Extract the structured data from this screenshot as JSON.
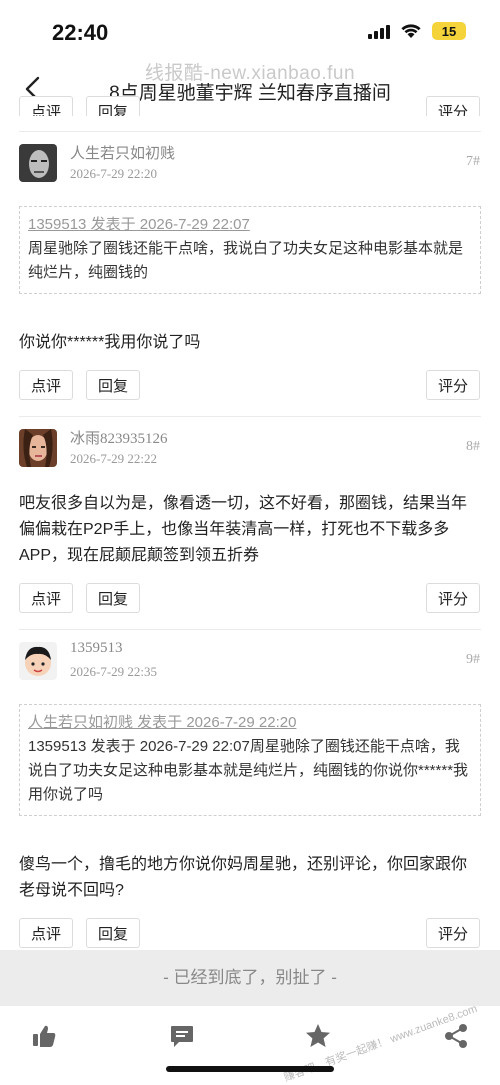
{
  "status": {
    "time": "22:40",
    "battery": "15"
  },
  "watermark": "线报酷-new.xianbao.fun",
  "nav": {
    "title": "8点周星驰董宇辉 兰知春序直播间"
  },
  "actions": {
    "comment": "点评",
    "reply": "回复",
    "rate": "评分"
  },
  "top_partial": {
    "comment": "点评",
    "reply": "回复",
    "rate": "评分"
  },
  "posts": [
    {
      "username": "人生若只如初贱",
      "time": "2026-7-29 22:20",
      "floor": "7#",
      "quote_head": "1359513 发表于 2026-7-29 22:07",
      "quote_text": "周星驰除了圈钱还能干点啥，我说白了功夫女足这种电影基本就是纯烂片，纯圈钱的",
      "body": "你说你******我用你说了吗"
    },
    {
      "username": "冰雨823935126",
      "time": "2026-7-29 22:22",
      "floor": "8#",
      "body": "吧友很多自以为是，像看透一切，这不好看，那圈钱，结果当年偏偏栽在P2P手上，也像当年装清高一样，打死也不下载多多APP，现在屁颠屁颠签到领五折券"
    },
    {
      "username": "1359513",
      "time": "2026-7-29 22:35",
      "floor": "9#",
      "quote_head": "人生若只如初贱 发表于 2026-7-29 22:20",
      "quote_text": "1359513 发表于 2026-7-29 22:07周星驰除了圈钱还能干点啥，我说白了功夫女足这种电影基本就是纯烂片，纯圈钱的你说你******我用你说了吗",
      "body": "傻鸟一个，撸毛的地方你说你妈周星驰，还别评论，你回家跟你老母说不回吗?"
    }
  ],
  "end_text": "- 已经到底了，别扯了 -",
  "corner_watermark": "赚客吧，有奖一起赚！ www.zuanke8.com",
  "tabs": [
    "like-icon",
    "comment-icon",
    "favorite-icon",
    "share-icon"
  ]
}
